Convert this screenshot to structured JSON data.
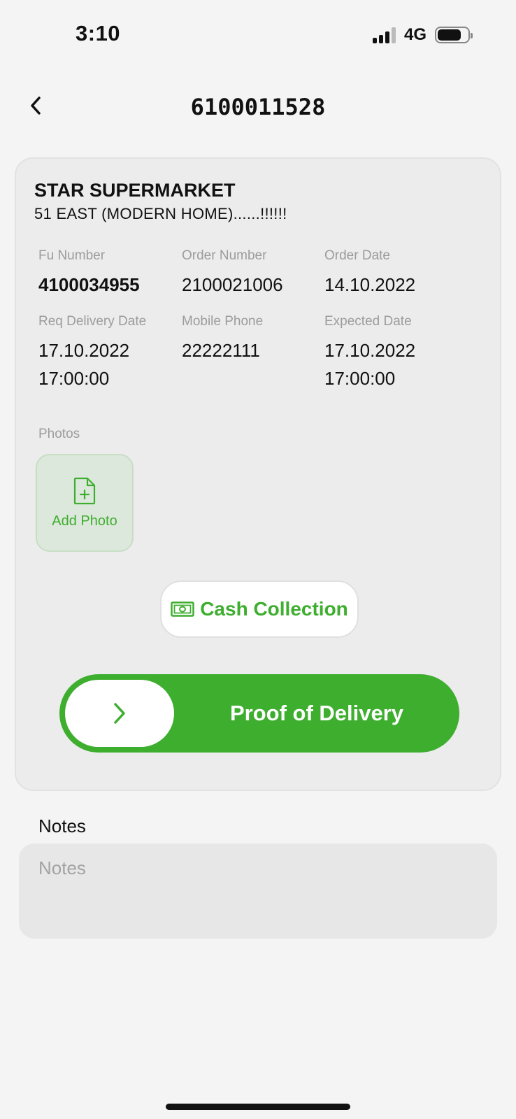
{
  "status_bar": {
    "time": "3:10",
    "network": "4G"
  },
  "header": {
    "title": "6100011528"
  },
  "card": {
    "store_name": "STAR SUPERMARKET",
    "address": "51 EAST (MODERN HOME)......!!!!!!",
    "fields": [
      {
        "label": "Fu Number",
        "value": "4100034955"
      },
      {
        "label": "Order Number",
        "value": "2100021006"
      },
      {
        "label": "Order Date",
        "value": "14.10.2022"
      },
      {
        "label": "Req Delivery Date",
        "value": "17.10.2022\n17:00:00"
      },
      {
        "label": "Mobile Phone",
        "value": "22222111"
      },
      {
        "label": "Expected Date",
        "value": "17.10.2022\n17:00:00"
      }
    ],
    "photos_label": "Photos",
    "add_photo_label": "Add Photo",
    "cash_collection_label": "Cash Collection",
    "proof_of_delivery_label": "Proof of Delivery"
  },
  "notes": {
    "label": "Notes",
    "placeholder": "Notes",
    "value": ""
  },
  "colors": {
    "accent": "#3eae2f",
    "card_bg": "#ececec",
    "page_bg": "#f4f4f4"
  }
}
